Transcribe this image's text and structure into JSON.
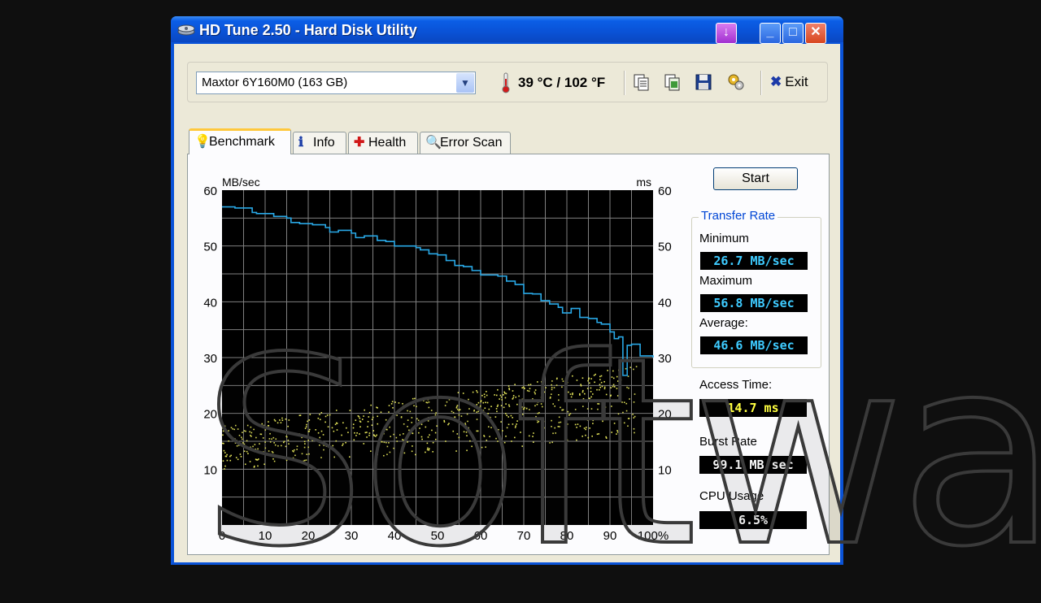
{
  "window": {
    "title": "HD Tune 2.50 - Hard Disk Utility"
  },
  "toolbar": {
    "drive": "Maxtor 6Y160M0 (163 GB)",
    "temperature": "39 °C / 102 °F",
    "exit_label": "Exit",
    "icons": [
      "copy-text-icon",
      "copy-image-icon",
      "save-icon",
      "options-icon"
    ]
  },
  "tabs": [
    {
      "label": "Benchmark",
      "icon": "bulb-icon",
      "active": true
    },
    {
      "label": "Info",
      "icon": "info-icon",
      "active": false
    },
    {
      "label": "Health",
      "icon": "health-cross-icon",
      "active": false
    },
    {
      "label": "Error Scan",
      "icon": "magnifier-icon",
      "active": false
    }
  ],
  "benchmark": {
    "start_label": "Start",
    "transfer_rate_title": "Transfer Rate",
    "minimum_label": "Minimum",
    "minimum_value": "26.7 MB/sec",
    "maximum_label": "Maximum",
    "maximum_value": "56.8 MB/sec",
    "average_label": "Average:",
    "average_value": "46.6 MB/sec",
    "access_time_label": "Access Time:",
    "access_time_value": "14.7 ms",
    "burst_rate_label": "Burst Rate",
    "burst_rate_value": "99.1 MB/sec",
    "cpu_usage_label": "CPU Usage",
    "cpu_usage_value": "6.5%"
  },
  "chart_data": {
    "type": "line",
    "ylabel_left": "MB/sec",
    "ylabel_right": "ms",
    "xlim": [
      0,
      100
    ],
    "ylim": [
      0,
      60
    ],
    "x_ticks": [
      "0",
      "10",
      "20",
      "30",
      "40",
      "50",
      "60",
      "70",
      "80",
      "90",
      "100%"
    ],
    "y_ticks": [
      "10",
      "20",
      "30",
      "40",
      "50",
      "60"
    ],
    "grid": true,
    "series": [
      {
        "color": "#29a8e6",
        "x": [
          0,
          3,
          7,
          8,
          12,
          15,
          16,
          18,
          21,
          24,
          25,
          27,
          30,
          31,
          33,
          36,
          38,
          40,
          42,
          45,
          46,
          48,
          50,
          52,
          54,
          56,
          58,
          60,
          62,
          64,
          66,
          68,
          70,
          72,
          74,
          76,
          78,
          79,
          81,
          83,
          85,
          87,
          88,
          90,
          91,
          92,
          93,
          94,
          95,
          97,
          100
        ],
        "y": [
          57,
          56.8,
          56,
          55.8,
          55.3,
          55,
          54.2,
          54,
          53.8,
          53.3,
          52.5,
          52.8,
          52.3,
          51.5,
          51.8,
          51,
          50.8,
          50,
          50,
          49.7,
          49.3,
          48.6,
          48.4,
          47.4,
          46.5,
          46.3,
          45.6,
          44.8,
          44.8,
          44.6,
          43.7,
          43.1,
          41.5,
          41.4,
          40.2,
          39.6,
          39,
          38,
          38.8,
          37.2,
          37,
          36.3,
          36,
          34.6,
          33.4,
          33.7,
          26.8,
          32.2,
          32.4,
          30.3,
          30
        ]
      }
    ],
    "scatter_note": "access time samples (ms), yellow dots"
  },
  "watermark": "Software"
}
